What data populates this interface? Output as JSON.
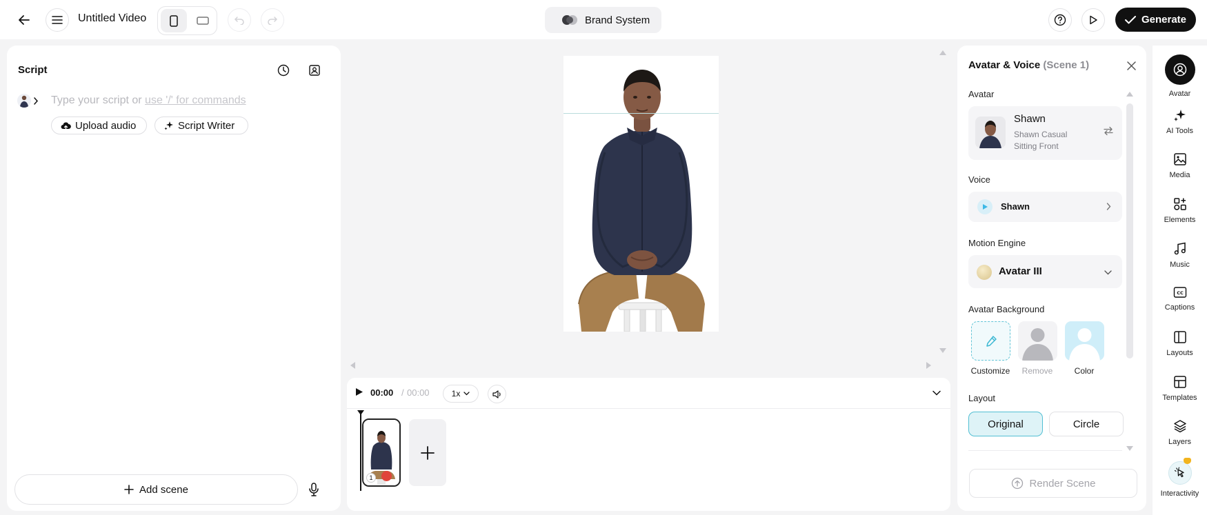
{
  "header": {
    "title": "Untitled Video",
    "brand": "Brand System",
    "generate_label": "Generate"
  },
  "script": {
    "title": "Script",
    "placeholder_lead": "Type your script or ",
    "placeholder_cmd": "use '/' for commands",
    "upload_audio": "Upload audio",
    "script_writer": "Script Writer",
    "add_scene": "Add scene"
  },
  "timeline": {
    "current_time": "00:00",
    "separator": "/",
    "total_time": "00:00",
    "speed": "1x"
  },
  "panel": {
    "title": "Avatar & Voice",
    "scene": "(Scene 1)",
    "avatar_label": "Avatar",
    "avatar_name": "Shawn",
    "avatar_variant": "Shawn Casual Sitting Front",
    "voice_label": "Voice",
    "voice_name": "Shawn",
    "engine_label": "Motion Engine",
    "engine_name": "Avatar III",
    "bg_label": "Avatar Background",
    "bg_options": [
      "Customize",
      "Remove",
      "Color"
    ],
    "layout_label": "Layout",
    "layout_options": [
      "Original",
      "Circle"
    ],
    "render_label": "Render Scene"
  },
  "rail": {
    "items": [
      "Avatar",
      "AI Tools",
      "Media",
      "Elements",
      "Music",
      "Captions",
      "Layouts",
      "Templates",
      "Layers",
      "Interactivity"
    ]
  },
  "colors": {
    "accent": "#111111",
    "selected_bg": "#def3f7",
    "selected_border": "#52bfd3",
    "play_accent": "#3bb8e6"
  }
}
